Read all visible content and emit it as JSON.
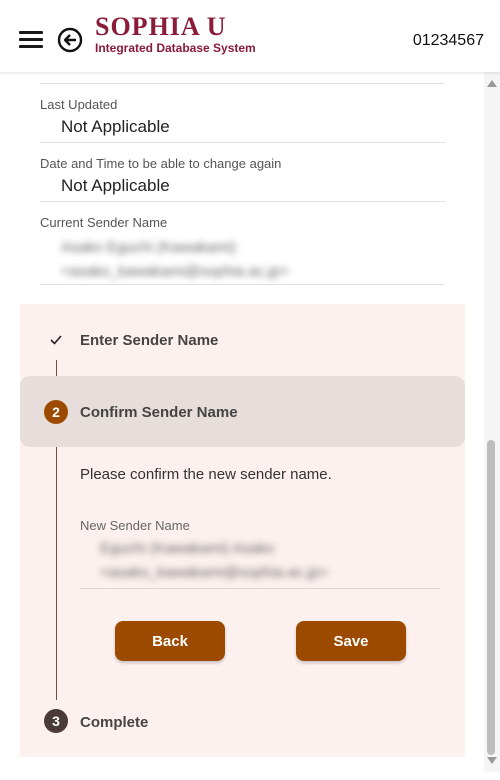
{
  "header": {
    "logo_title": "SOPHIA U",
    "logo_subtitle": "Integrated Database System",
    "user_id": "01234567"
  },
  "fields": {
    "last_updated": {
      "label": "Last Updated",
      "value": "Not Applicable"
    },
    "change_again": {
      "label": "Date and Time to be able to change again",
      "value": "Not Applicable"
    },
    "current_sender": {
      "label": "Current Sender Name",
      "value_line1": "Asako Eguchi (Kawakami)",
      "value_line2": "<asako_kawakami@sophia.ac.jp>"
    }
  },
  "stepper": {
    "step1": {
      "title": "Enter Sender Name",
      "icon": "check-icon"
    },
    "step2": {
      "number": "2",
      "title": "Confirm Sender Name"
    },
    "step2_body": {
      "instruction": "Please confirm the new sender name.",
      "new_sender_label": "New Sender Name",
      "new_sender_line1": "Eguchi (Kawakami) Asako",
      "new_sender_line2": "<asako_kawakami@sophia.ac.jp>"
    },
    "buttons": {
      "back": "Back",
      "save": "Save"
    },
    "step3": {
      "number": "3",
      "title": "Complete"
    }
  },
  "colors": {
    "brand": "#8a1c3a",
    "button": "#9b4a00",
    "stepper_bg": "#fdf1ef",
    "active_step_bg": "#e7dddb",
    "inactive_circle": "#4a3b36"
  }
}
